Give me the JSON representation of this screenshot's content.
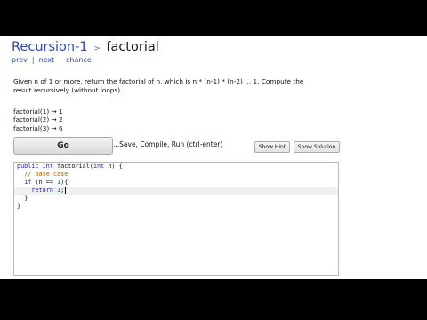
{
  "header": {
    "crumb": "Recursion-1",
    "sep": ">",
    "title": "factorial"
  },
  "nav": {
    "prev": "prev",
    "next": "next",
    "chance": "chance",
    "bar": "|"
  },
  "problem": {
    "description": "Given n of 1 or more, return the factorial of n, which is n * (n-1) * (n-2) ... 1. Compute the result recursively (without loops).",
    "examples": [
      "factorial(1) → 1",
      "factorial(2) → 2",
      "factorial(3) → 6"
    ]
  },
  "toolbar": {
    "go_label": "Go",
    "go_hint": "...Save, Compile, Run (ctrl-enter)",
    "show_hint_label": "Show Hint",
    "show_solution_label": "Show Solution"
  },
  "code": {
    "l1_kw1": "public",
    "l1_kw2": "int",
    "l1_name": " factorial(",
    "l1_kw3": "int",
    "l1_param": "n",
    "l1_end": ") {",
    "l2_comment": "// base case",
    "l3_kw": "if",
    "l3_a": " (n ",
    "l3_op": "==",
    "l3_b": " ",
    "l3_num": "1",
    "l3_end": "){",
    "l4_kw": "return",
    "l4_num": "1",
    "l4_end": ";",
    "l5": "}",
    "l6": "}"
  }
}
